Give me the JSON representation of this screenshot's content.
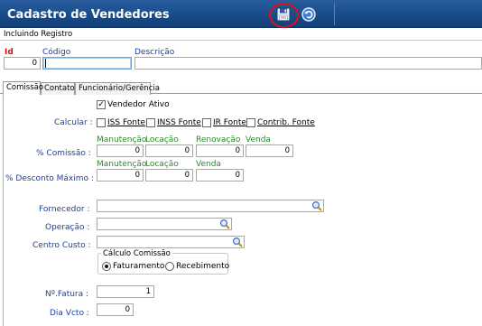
{
  "window": {
    "title": "Cadastro de Vendedores"
  },
  "toolbar": {
    "save_icon": "floppy-disk-icon",
    "back_icon": "undo-arrow-icon"
  },
  "status": {
    "text": "Incluindo Registro"
  },
  "header": {
    "id_label": "Id",
    "id_value": "0",
    "codigo_label": "Código",
    "codigo_value": "",
    "descricao_label": "Descrição",
    "descricao_value": ""
  },
  "tabs": [
    {
      "label": "Comissão"
    },
    {
      "label": "Contato"
    },
    {
      "label": "Funcionário/Gerência"
    }
  ],
  "form": {
    "vendedor_ativo": {
      "label": "Vendedor Ativo",
      "checked": true
    },
    "calcular": {
      "label": "Calcular :",
      "options": [
        "ISS Fonte",
        "INSS Fonte",
        "IR Fonte",
        "Contrib. Fonte"
      ]
    },
    "comissao": {
      "label": "% Comissão :",
      "columns": [
        "Manutenção",
        "Locação",
        "Renovação",
        "Venda"
      ],
      "values": [
        "0",
        "0",
        "0",
        "0"
      ]
    },
    "desconto_maximo": {
      "label": "% Desconto Máximo :",
      "columns": [
        "Manutenção",
        "Locação",
        "Venda"
      ],
      "values": [
        "0",
        "0",
        "0"
      ]
    },
    "fornecedor": {
      "label": "Fornecedor :",
      "value": ""
    },
    "operacao": {
      "label": "Operação :",
      "value": ""
    },
    "centro_custo": {
      "label": "Centro Custo :",
      "value": ""
    },
    "calculo_comissao": {
      "legend": "Cálculo Comissão",
      "options": [
        "Faturamento",
        "Recebimento"
      ],
      "selected": "Faturamento"
    },
    "nr_fatura": {
      "label": "Nº.Fatura :",
      "value": "1"
    },
    "dia_vcto": {
      "label": "Dia Vcto :",
      "value": "0"
    }
  },
  "colors": {
    "titlebar": "#174a88",
    "required_label": "#d01010",
    "field_label": "#1a3fa0",
    "group_label": "#2a8a2a",
    "highlight_circle": "#e01010"
  }
}
